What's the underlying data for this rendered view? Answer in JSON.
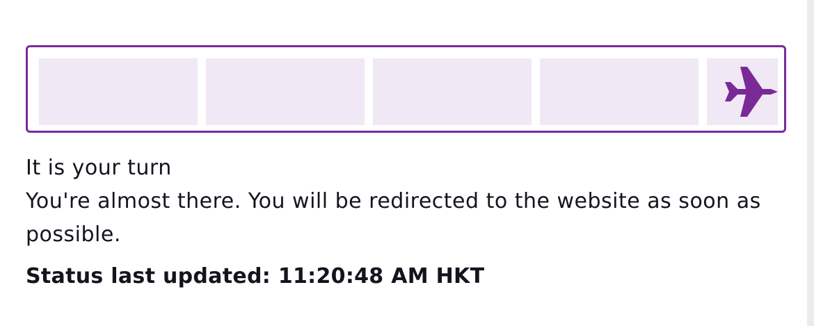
{
  "queue": {
    "progress_segments_total": 5,
    "progress_current_segment": 5,
    "progress_icon": "airplane-icon",
    "accent_color": "#7a2a96",
    "segment_color": "#f0e8f5"
  },
  "message": {
    "heading": "It is your turn",
    "body": "You're almost there. You will be redirected to the website as soon as possible."
  },
  "status": {
    "label": "Status last updated:",
    "time": "11:20:48 AM HKT"
  }
}
